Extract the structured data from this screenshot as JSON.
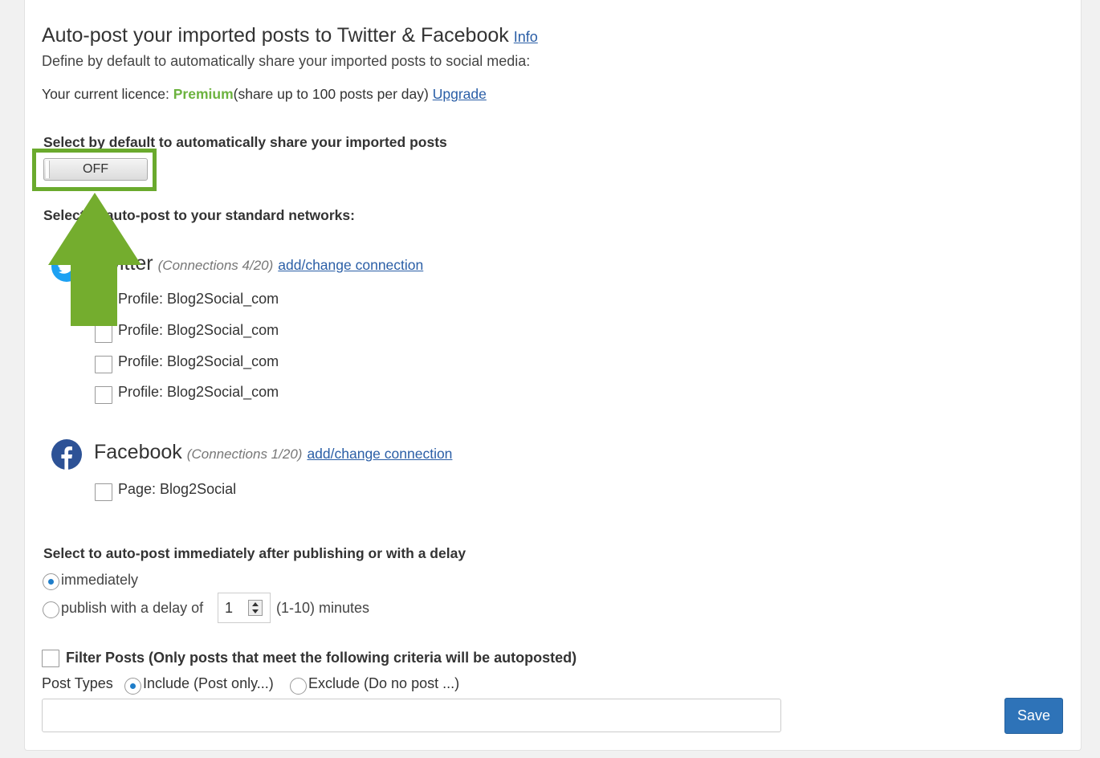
{
  "header": {
    "title": "Auto-post your imported posts to Twitter & Facebook",
    "info_link": "Info",
    "description": "Define by default to automatically share your imported posts to social media:"
  },
  "licence": {
    "prefix": "Your current licence: ",
    "level": "Premium",
    "detail": "(share up to 100 posts per day)",
    "upgrade_link": "Upgrade"
  },
  "auto_share": {
    "heading": "Select by default to automatically share your imported posts",
    "toggle_label": "OFF"
  },
  "networks": {
    "heading": "Select to auto-post to your standard networks:",
    "twitter": {
      "name": "Twitter",
      "connections": "(Connections 4/20)",
      "link": "add/change connection",
      "profiles": [
        "Profile: Blog2Social_com",
        "Profile: Blog2Social_com",
        "Profile: Blog2Social_com",
        "Profile: Blog2Social_com"
      ]
    },
    "facebook": {
      "name": "Facebook",
      "connections": "(Connections 1/20)",
      "link": "add/change connection",
      "pages": [
        "Page: Blog2Social"
      ]
    }
  },
  "delay": {
    "heading": "Select to auto-post immediately after publishing or with a delay",
    "option_immediately": "immediately",
    "option_delay_prefix": "publish with a delay of",
    "delay_value": "1",
    "delay_suffix": "(1-10) minutes",
    "selected": "immediately"
  },
  "filter": {
    "label": "Filter Posts (Only posts that meet the following criteria will be autoposted)",
    "post_types_label": "Post Types",
    "include_label": "Include (Post only...)",
    "exclude_label": "Exclude (Do no post ...)",
    "selected": "include",
    "input_value": ""
  },
  "actions": {
    "save_label": "Save"
  },
  "colors": {
    "premium": "#6cb33f",
    "highlight": "#6aaa2d",
    "twitter": "#1da1f2",
    "facebook": "#2d5296",
    "save_button": "#2e73b8"
  },
  "icons": {
    "twitter": "twitter-icon",
    "facebook": "facebook-icon",
    "arrow": "up-arrow-icon"
  }
}
